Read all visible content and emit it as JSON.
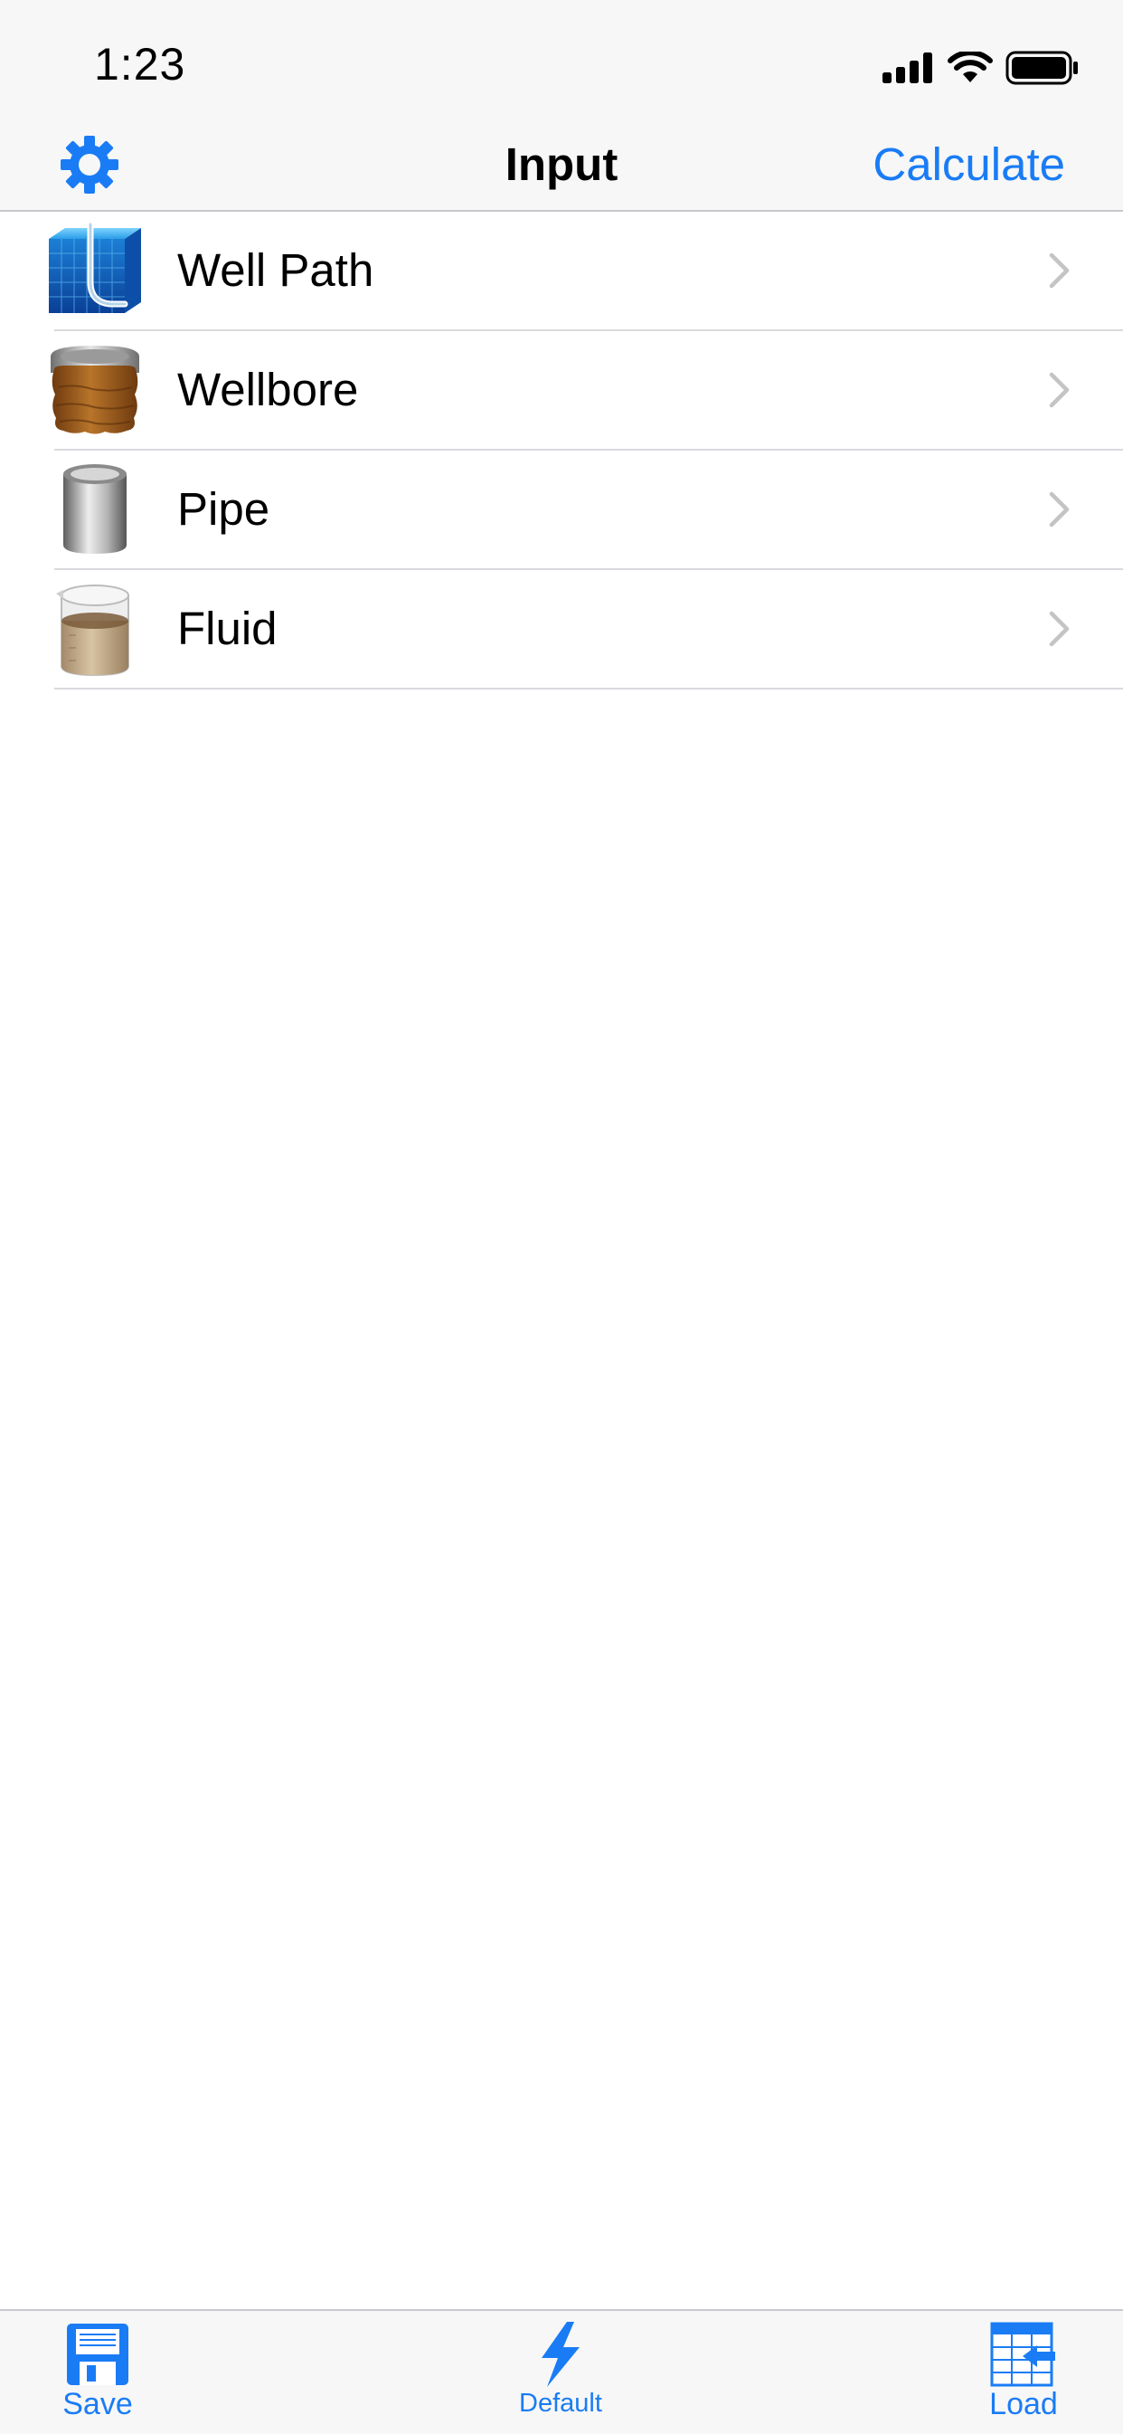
{
  "status_bar": {
    "time": "1:23",
    "icons": [
      "signal-icon",
      "wifi-icon",
      "battery-icon"
    ]
  },
  "nav": {
    "title": "Input",
    "left_icon": "gear-icon",
    "right_action": "Calculate"
  },
  "items": [
    {
      "label": "Well Path",
      "icon": "well-path-icon"
    },
    {
      "label": "Wellbore",
      "icon": "wellbore-icon"
    },
    {
      "label": "Pipe",
      "icon": "pipe-icon"
    },
    {
      "label": "Fluid",
      "icon": "fluid-beaker-icon"
    }
  ],
  "tab_bar": {
    "save": {
      "label": "Save",
      "icon": "floppy-disk-icon"
    },
    "default": {
      "label": "Default",
      "icon": "lightning-bolt-icon"
    },
    "load": {
      "label": "Load",
      "icon": "table-import-icon"
    }
  },
  "colors": {
    "accent": "#1a7cf5",
    "bar_background": "#f7f7f7",
    "separator": "#c8c7cc"
  }
}
